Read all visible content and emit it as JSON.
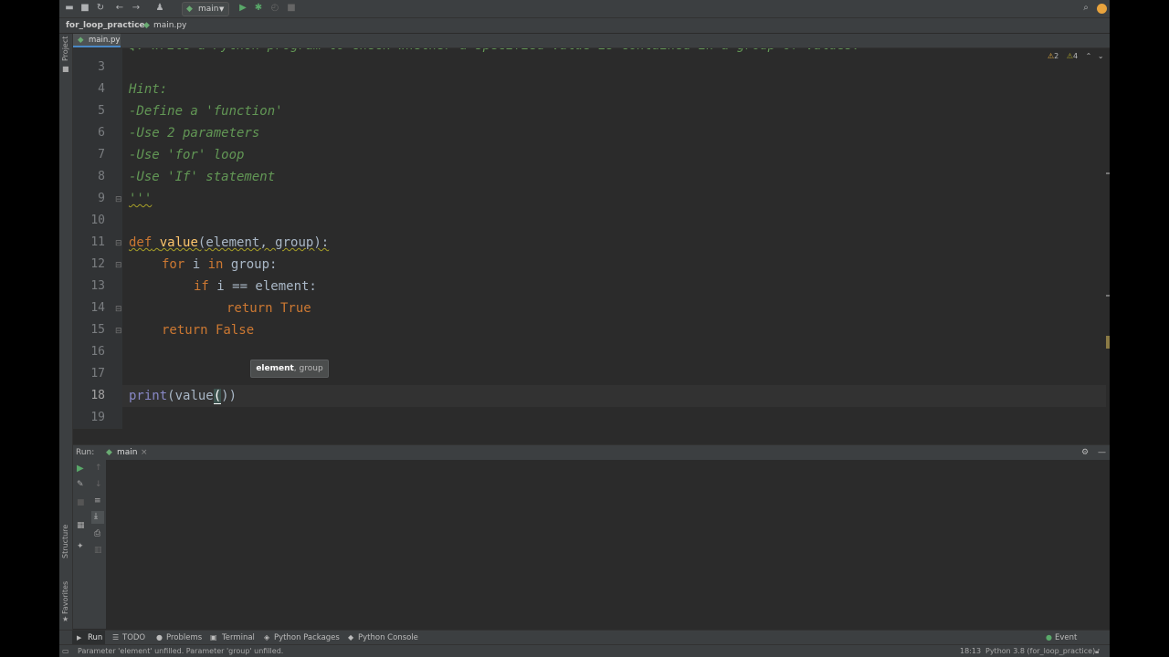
{
  "navbar": {
    "project": "for_loop_practice",
    "file": "main.py"
  },
  "toolbar": {
    "branch": "main"
  },
  "tabs": [
    {
      "label": "main.py"
    }
  ],
  "left_strip": {
    "project": "Project",
    "structure": "Structure",
    "favorites": "Favorites"
  },
  "inspections": {
    "warnings": "2",
    "weak_warnings": "4"
  },
  "editor": {
    "top_partial": "Q: Write a Python program to check whether a specified value is contained in a group of values.",
    "line_numbers": [
      "3",
      "4",
      "5",
      "6",
      "7",
      "8",
      "9",
      "10",
      "11",
      "12",
      "13",
      "14",
      "15",
      "16",
      "17",
      "18",
      "19"
    ],
    "hint": "Hint:",
    "hint1": "-Define a 'function'",
    "hint2": "-Use 2 parameters",
    "hint3": "-Use 'for' loop",
    "hint4": "-Use 'If' statement",
    "docend": "'''",
    "def_kw": "def",
    "def_name": "value",
    "def_params": "(element, group):",
    "for_kw": "for",
    "for_var": " i ",
    "in_kw": "in",
    "for_rest": " group:",
    "if_kw": "if",
    "if_rest": " i == element:",
    "return_true": "return True",
    "return_false": "return False",
    "print_kw": "print",
    "print_open": "(value",
    "caret_paren": "(",
    "print_close": ")",
    "tooltip_bold": "element",
    "tooltip_rest": ", group"
  },
  "run": {
    "label": "Run:",
    "tab": "main"
  },
  "bottom_tabs": [
    "Run",
    "TODO",
    "Problems",
    "Terminal",
    "Python Packages",
    "Python Console"
  ],
  "event_log": "Event Log",
  "status": {
    "message": "Parameter 'element' unfilled. Parameter 'group' unfilled.",
    "position": "18:13",
    "interpreter": "Python 3.8 (for_loop_practice)"
  },
  "colors": {
    "comment": "#629755",
    "keyword": "#cc7832",
    "function": "#ffc66d",
    "builtin": "#8888c6",
    "text": "#a9b7c6"
  }
}
